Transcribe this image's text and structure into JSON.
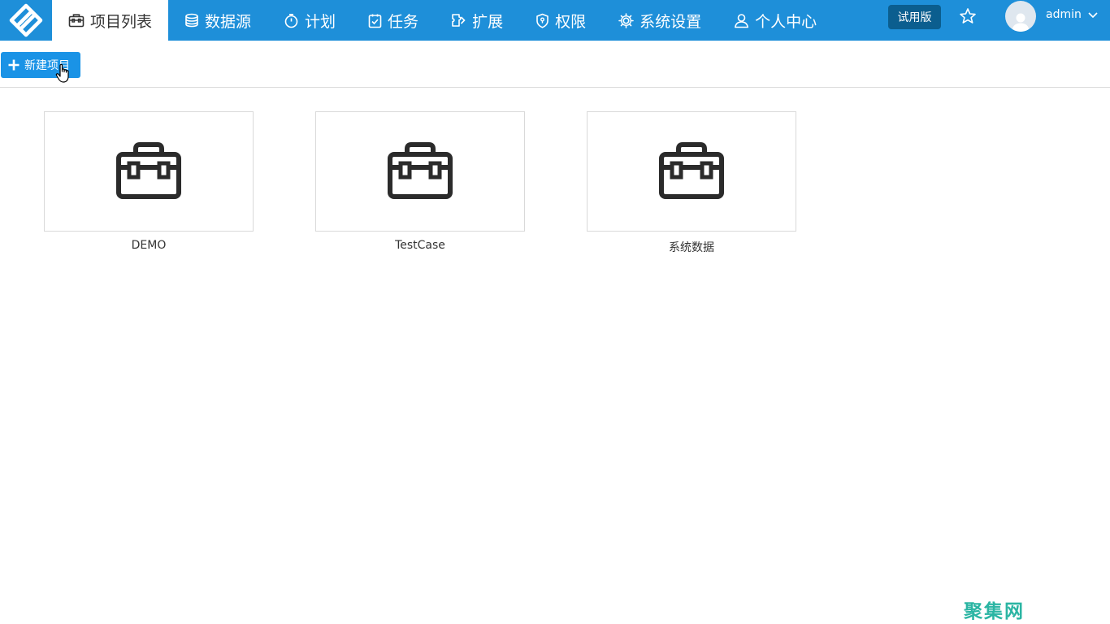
{
  "nav": {
    "items": [
      {
        "label": "项目列表",
        "icon": "toolbox-icon",
        "active": true
      },
      {
        "label": "数据源",
        "icon": "database-icon",
        "active": false
      },
      {
        "label": "计划",
        "icon": "timer-icon",
        "active": false
      },
      {
        "label": "任务",
        "icon": "task-icon",
        "active": false
      },
      {
        "label": "扩展",
        "icon": "extension-icon",
        "active": false
      },
      {
        "label": "权限",
        "icon": "shield-icon",
        "active": false
      },
      {
        "label": "系统设置",
        "icon": "gear-icon",
        "active": false
      },
      {
        "label": "个人中心",
        "icon": "user-icon",
        "active": false
      }
    ],
    "trial_label": "试用版",
    "user_name": "admin"
  },
  "toolbar": {
    "new_project_label": "新建项目"
  },
  "projects": [
    {
      "name": "DEMO",
      "icon": "briefcase-icon"
    },
    {
      "name": "TestCase",
      "icon": "briefcase-icon"
    },
    {
      "name": "系统数据",
      "icon": "briefcase-icon"
    }
  ],
  "watermark": "聚集网",
  "colors": {
    "nav_bg": "#1e8fd9",
    "trial_bg": "#0b5e8f",
    "button_bg": "#1a93e6",
    "watermark": "#2bb5a3"
  }
}
